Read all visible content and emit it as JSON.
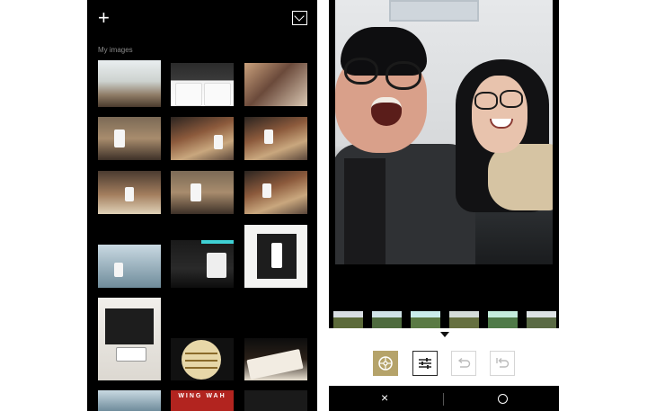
{
  "gallery": {
    "section_label": "My images",
    "add_icon": "plus-icon",
    "import_icon": "inbox-icon",
    "thumbnails": [
      "photo",
      "photo",
      "photo",
      "photo",
      "photo",
      "photo",
      "photo",
      "photo",
      "photo",
      "photo",
      "photo",
      "photo",
      "photo",
      "photo",
      "photo",
      "photo",
      "photo",
      "photo"
    ],
    "packaging_text": "WING WAH"
  },
  "editor": {
    "tools": [
      "filters-icon",
      "adjust-icon",
      "undo-icon",
      "history-icon"
    ],
    "cancel_icon": "close-icon",
    "cancel_label": "×",
    "confirm_icon": "confirm-circle-icon",
    "accent_color": "#b5a36a"
  }
}
